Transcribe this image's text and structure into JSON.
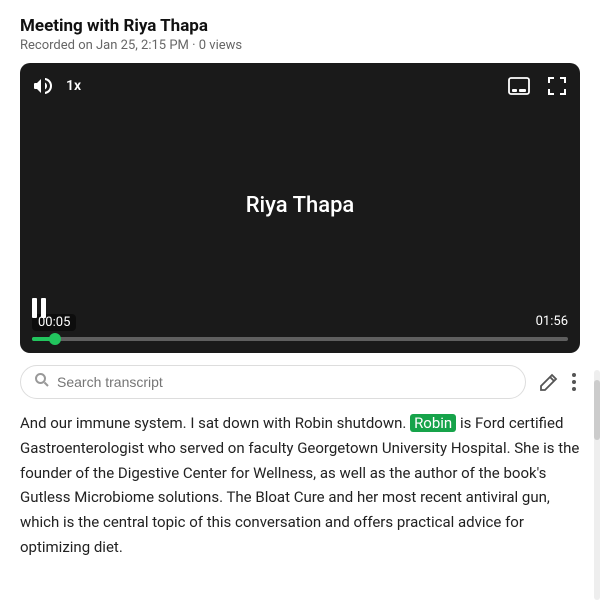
{
  "header": {
    "title": "Meeting with Riya Thapa",
    "meta": "Recorded on Jan 25, 2:15 PM · 0 views"
  },
  "video": {
    "center_text": "Riya Thapa",
    "time_current": "00:05",
    "time_total": "01:56",
    "progress_percent": 4.3,
    "speed": "1x"
  },
  "toolbar": {
    "search_placeholder": "Search transcript"
  },
  "transcript": {
    "before_highlight": "And our immune system. I sat down with Robin shutdown. ",
    "highlight_word": "Robin",
    "after_highlight": " is Ford certified Gastroenterologist who served on faculty Georgetown University Hospital. She is the founder of the Digestive Center for Wellness, as well as the author of the book's Gutless Microbiome solutions. The Bloat Cure and her most recent antiviral gun, which is the central topic of this conversation and offers practical advice for optimizing diet."
  }
}
